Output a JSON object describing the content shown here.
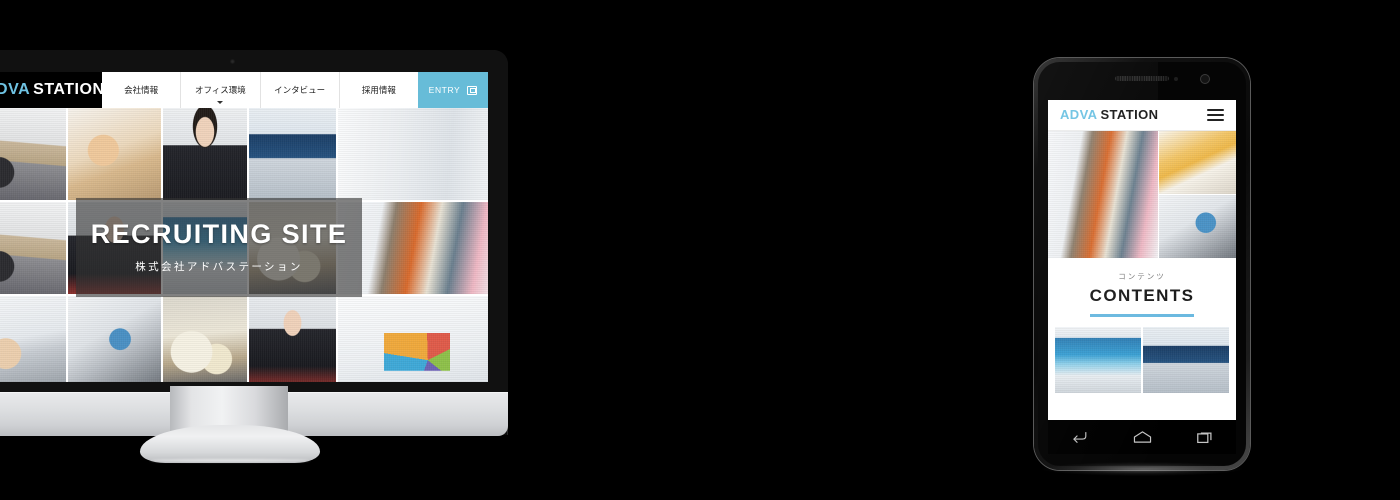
{
  "scene": {
    "devices": [
      "imac-desktop-mockup",
      "android-phone-mockup"
    ],
    "background_color": "#000000"
  },
  "desktop": {
    "logo": {
      "primary": "ADVA",
      "secondary": "STATION",
      "primary_color": "#6fc3e3",
      "secondary_color": "#ffffff"
    },
    "nav": [
      {
        "label": "会社情報",
        "has_dropdown": false
      },
      {
        "label": "オフィス環境",
        "has_dropdown": true
      },
      {
        "label": "インタビュー",
        "has_dropdown": false
      },
      {
        "label": "採用情報",
        "has_dropdown": false
      }
    ],
    "entry": {
      "label": "ENTRY",
      "icon": "external-link-icon",
      "background": "#67bcd8"
    },
    "hero": {
      "title": "RECRUITING SITE",
      "subtitle": "株式会社アドバステーション",
      "overlay_color": "rgba(52,52,52,0.62)",
      "tiles": [
        "meeting-room-photo",
        "person-writing-photo",
        "smiling-businessman-photo",
        "monitor-desk-photo",
        "office-group-photo",
        "window-light-photo",
        "businessman-portrait-photo",
        "office-interior-photo",
        "team-meeting-photo",
        "standing-team-photo",
        "laptop-keyboard-photo",
        "smartphone-hand-photo",
        "round-table-meeting-photo",
        "man-with-notebook-photo",
        "pie-chart-report-photo"
      ]
    }
  },
  "phone": {
    "logo": {
      "primary": "ADVA",
      "secondary": "STATION",
      "primary_color": "#6fc3e3",
      "secondary_color": "#1a1a1a"
    },
    "menu_icon": "hamburger-menu-icon",
    "hero_tiles": [
      "standing-team-photo",
      "documents-desk-photo",
      "tablet-hand-photo"
    ],
    "contents": {
      "kicker": "コンテンツ",
      "heading": "CONTENTS",
      "rule_color": "#6bb9e0"
    },
    "cards": [
      "blue-office-interior-photo",
      "monitor-chart-photo"
    ],
    "navbar": [
      {
        "icon": "android-back-icon"
      },
      {
        "icon": "android-home-icon"
      },
      {
        "icon": "android-recents-icon"
      }
    ]
  }
}
